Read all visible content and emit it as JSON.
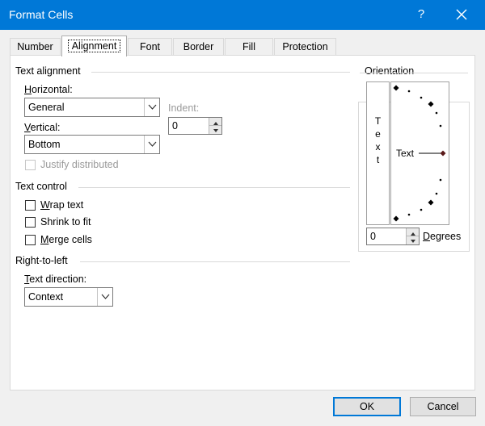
{
  "window": {
    "title": "Format Cells",
    "help_label": "?"
  },
  "tabs": [
    {
      "label": "Number"
    },
    {
      "label": "Alignment"
    },
    {
      "label": "Font"
    },
    {
      "label": "Border"
    },
    {
      "label": "Fill"
    },
    {
      "label": "Protection"
    }
  ],
  "text_alignment": {
    "heading": "Text alignment",
    "horizontal_label": "Horizontal:",
    "horizontal_value": "General",
    "indent_label": "Indent:",
    "indent_value": "0",
    "vertical_label": "Vertical:",
    "vertical_value": "Bottom",
    "justify_label": "Justify distributed",
    "justify_checked": false
  },
  "text_control": {
    "heading": "Text control",
    "wrap_label": "Wrap text",
    "wrap_checked": false,
    "shrink_label": "Shrink to fit",
    "shrink_checked": false,
    "merge_label": "Merge cells",
    "merge_checked": false
  },
  "rtl": {
    "heading": "Right-to-left",
    "direction_label": "Text direction:",
    "direction_value": "Context"
  },
  "orientation": {
    "heading": "Orientation",
    "vertical_text": "Text",
    "dial_text": "Text",
    "degrees_value": "0",
    "degrees_label": "Degrees"
  },
  "buttons": {
    "ok": "OK",
    "cancel": "Cancel"
  },
  "colors": {
    "titlebar": "#0078d7",
    "default_button_border": "#0078d7",
    "dial_marker": "#5a1a1a"
  }
}
